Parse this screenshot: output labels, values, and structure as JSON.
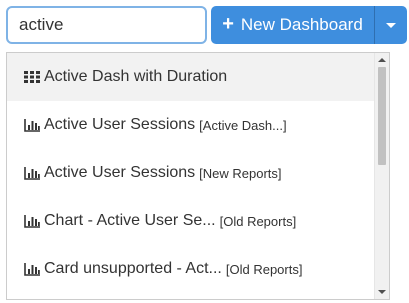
{
  "search": {
    "value": "active",
    "clear_icon": "times-circle-icon"
  },
  "new_dashboard_button": {
    "icon": "plus-icon",
    "label": "New Dashboard",
    "accent": "#3e8ede"
  },
  "dropdown": {
    "items": [
      {
        "icon": "grid-icon",
        "title": "Active Dash with Duration",
        "sub": "",
        "highlighted": true
      },
      {
        "icon": "bar-chart-icon",
        "title": "Active User Sessions",
        "sub": "[Active Dash...]"
      },
      {
        "icon": "bar-chart-icon",
        "title": "Active User Sessions",
        "sub": "[New Reports]"
      },
      {
        "icon": "bar-chart-icon",
        "title": "Chart - Active User Se...",
        "sub": "[Old Reports]"
      },
      {
        "icon": "bar-chart-icon",
        "title": "Card unsupported - Act...",
        "sub": "[Old Reports]"
      }
    ]
  }
}
